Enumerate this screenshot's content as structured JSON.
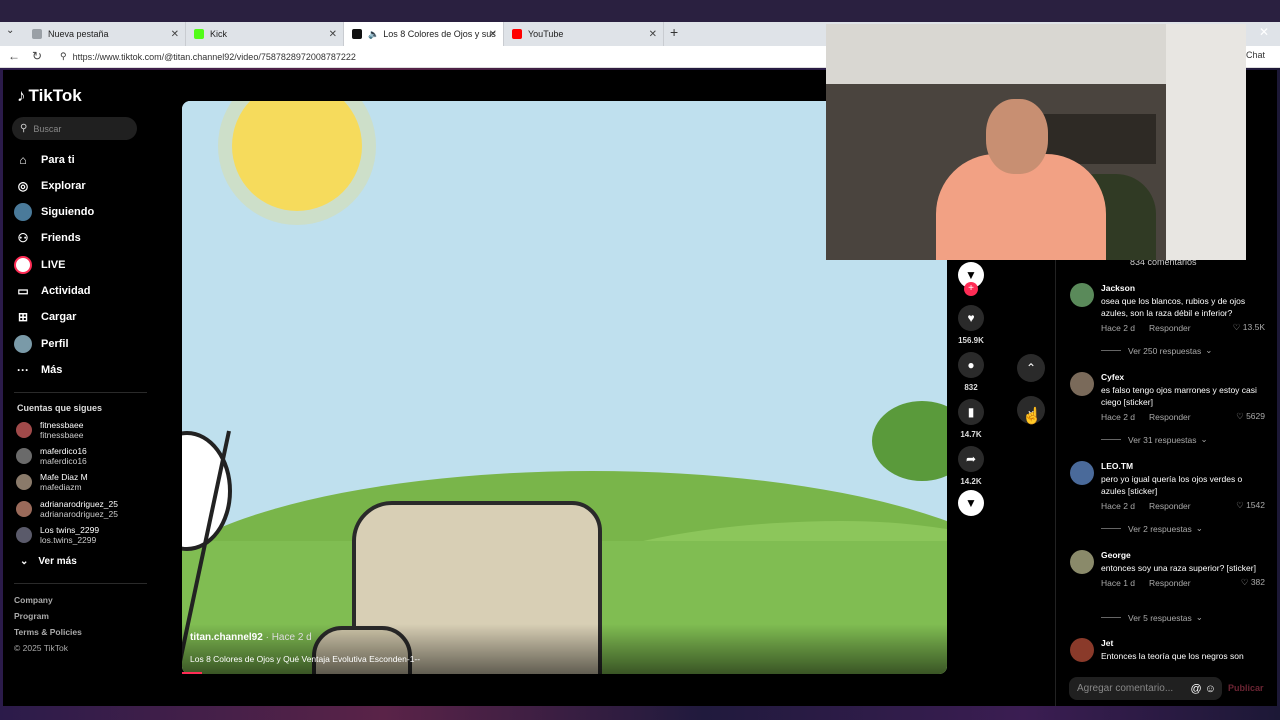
{
  "browser": {
    "tabs": [
      {
        "title": "Nueva pestaña",
        "active": false,
        "favicon_color": "#9aa0a6"
      },
      {
        "title": "Kick",
        "active": false,
        "favicon_color": "#53fc18"
      },
      {
        "title": "Los 8 Colores de Ojos y sus",
        "active": true,
        "favicon_color": "#111111"
      },
      {
        "title": "YouTube",
        "active": false,
        "favicon_color": "#ff0000"
      }
    ],
    "url": "https://www.tiktok.com/@titan.channel92/video/7587828972008787222",
    "chat_label": "Chat"
  },
  "tiktok": {
    "logo": "TikTok",
    "search_placeholder": "Buscar",
    "nav": [
      {
        "label": "Para ti",
        "icon": "home-icon"
      },
      {
        "label": "Explorar",
        "icon": "compass-icon"
      },
      {
        "label": "Siguiendo",
        "icon": "following-avatar-icon"
      },
      {
        "label": "Friends",
        "icon": "friends-icon"
      },
      {
        "label": "LIVE",
        "icon": "live-icon"
      },
      {
        "label": "Actividad",
        "icon": "activity-icon"
      },
      {
        "label": "Cargar",
        "icon": "upload-icon"
      },
      {
        "label": "Perfil",
        "icon": "profile-avatar-icon"
      },
      {
        "label": "Más",
        "icon": "more-icon"
      }
    ],
    "following_title": "Cuentas que sigues",
    "following": [
      {
        "name": "fitnessbaee",
        "user": "fitnessbaee"
      },
      {
        "name": "maferdico16",
        "user": "maferdico16"
      },
      {
        "name": "Mafe Diaz M",
        "user": "mafediazm"
      },
      {
        "name": "adrianarodriguez_25",
        "user": "adrianarodriguez_25"
      },
      {
        "name": "Los twins_2299",
        "user": "los.twins_2299"
      }
    ],
    "see_more": "Ver más",
    "footer": [
      "Company",
      "Program",
      "Terms & Policies",
      "© 2025 TikTok"
    ]
  },
  "video": {
    "author": "titan.channel92",
    "time": " · Hace 2 d",
    "description": "Los 8 Colores de Ojos y Qué Ventaja Evolutiva Esconden-1--"
  },
  "actions": {
    "likes": "156.9K",
    "comments": "832",
    "saves": "14.7K",
    "shares": "14.2K"
  },
  "comments_panel": {
    "count": "834 comentarios",
    "items": [
      {
        "user": "Jackson",
        "text": "osea que los blancos, rubios y de ojos azules, son la raza débil e inferior?",
        "time": "Hace 2 d",
        "reply": "Responder",
        "likes": "13.5K",
        "replies": "Ver 250 respuestas"
      },
      {
        "user": "Cyfex",
        "text": "es falso tengo ojos marrones y estoy casi ciego [sticker]",
        "time": "Hace 2 d",
        "reply": "Responder",
        "likes": "5629",
        "replies": "Ver 31 respuestas"
      },
      {
        "user": "LEO.TM",
        "text": "pero yo igual quería los ojos verdes o azules [sticker]",
        "time": "Hace 2 d",
        "reply": "Responder",
        "likes": "1542",
        "replies": "Ver 2 respuestas"
      },
      {
        "user": "George",
        "text": "entonces soy una raza superior? [sticker]",
        "time": "Hace 1 d",
        "reply": "Responder",
        "likes": "382",
        "replies": "Ver 5 respuestas"
      },
      {
        "user": "Jet",
        "text": "Entonces la teoría que los negros son",
        "time": "",
        "reply": "",
        "likes": "",
        "replies": ""
      }
    ],
    "add_placeholder": "Agregar comentario...",
    "publish": "Publicar"
  }
}
